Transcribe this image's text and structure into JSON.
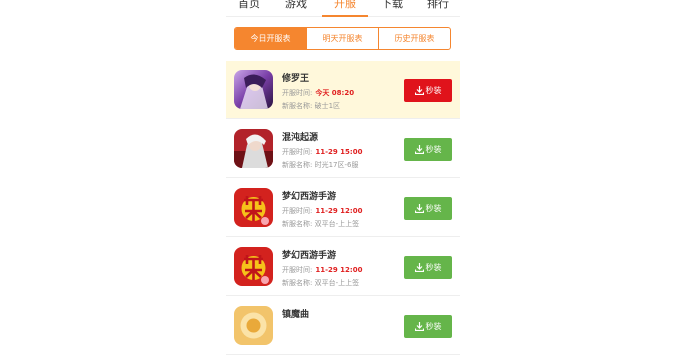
{
  "nav": {
    "items": [
      "首页",
      "游戏",
      "开服",
      "下载",
      "排行"
    ],
    "active_index": 2
  },
  "segments": {
    "items": [
      "今日开服表",
      "明天开服表",
      "历史开服表"
    ],
    "active_index": 0
  },
  "colors": {
    "accent": "#f5862f",
    "highlight_row": "#fff8db",
    "time_red": "#e02020",
    "button_red": "#e0131b",
    "button_green": "#65b54a"
  },
  "labels": {
    "open_time": "开服时间:",
    "server_name": "新服名称:"
  },
  "servers": [
    {
      "name": "修罗王",
      "time": "今天 08:20",
      "server": "破士1区",
      "button": "秒装",
      "icon": "xiuluowang-game-icon",
      "highlight": true
    },
    {
      "name": "混沌起源",
      "time": "11-29 15:00",
      "server": "时光17区-6服",
      "button": "秒装",
      "icon": "hundun-game-icon",
      "highlight": false
    },
    {
      "name": "梦幻西游手游",
      "time": "11-29 12:00",
      "server": "双平台-上上签",
      "button": "秒装",
      "icon": "menghuan-game-icon",
      "highlight": false
    },
    {
      "name": "梦幻西游手游",
      "time": "11-29 12:00",
      "server": "双平台-上上签",
      "button": "秒装",
      "icon": "menghuan-game-icon",
      "highlight": false
    },
    {
      "name": "镇魔曲",
      "time": "",
      "server": "",
      "button": "秒装",
      "icon": "zhenmoqu-game-icon",
      "highlight": false
    }
  ]
}
